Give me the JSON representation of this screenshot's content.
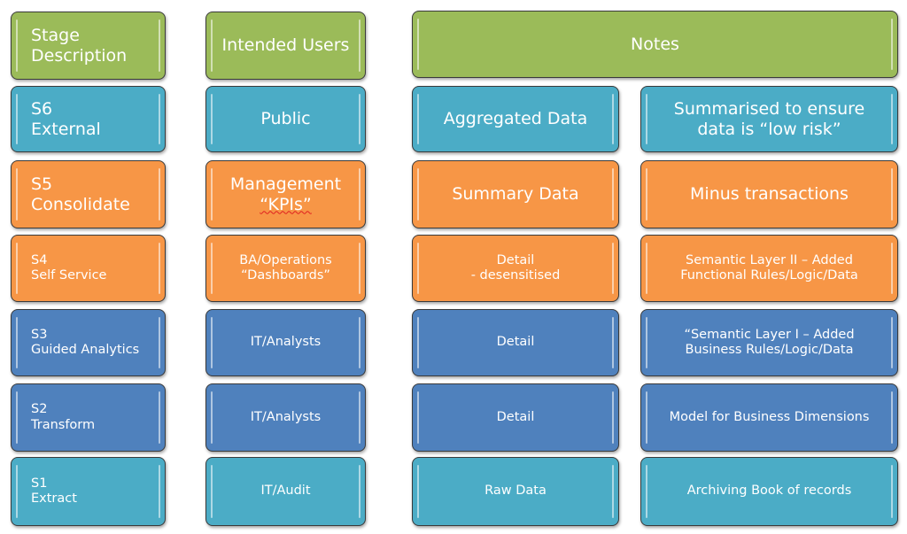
{
  "colors": {
    "green": "#9bbb59",
    "teal": "#4bacc6",
    "orange": "#f79646",
    "blue": "#4f81bd"
  },
  "header": {
    "stage": "Stage\nDescription",
    "users": "Intended Users",
    "notes": "Notes"
  },
  "rows": [
    {
      "stage": "S6\nExternal",
      "users": "Public",
      "data": "Aggregated Data",
      "notes": "Summarised to ensure\ndata is “low risk”",
      "color": "teal"
    },
    {
      "stage": "S5\nConsolidate",
      "users_line1": "Management",
      "users_line2": "“KPIs”",
      "data": "Summary Data",
      "notes": "Minus transactions",
      "color": "orange"
    },
    {
      "stage": "S4\nSelf Service",
      "users": "BA/Operations\n“Dashboards”",
      "data": "Detail\n- desensitised",
      "notes": "Semantic Layer II – Added\nFunctional Rules/Logic/Data",
      "color": "orange"
    },
    {
      "stage": "S3\nGuided Analytics",
      "users": "IT/Analysts",
      "data": "Detail",
      "notes": "“Semantic Layer I – Added\nBusiness Rules/Logic/Data",
      "color": "blue"
    },
    {
      "stage": "S2\nTransform",
      "users": "IT/Analysts",
      "data": "Detail",
      "notes": "Model for Business Dimensions",
      "color": "blue"
    },
    {
      "stage": "S1\nExtract",
      "users": "IT/Audit",
      "data": "Raw Data",
      "notes": "Archiving Book of records",
      "color": "teal"
    }
  ]
}
